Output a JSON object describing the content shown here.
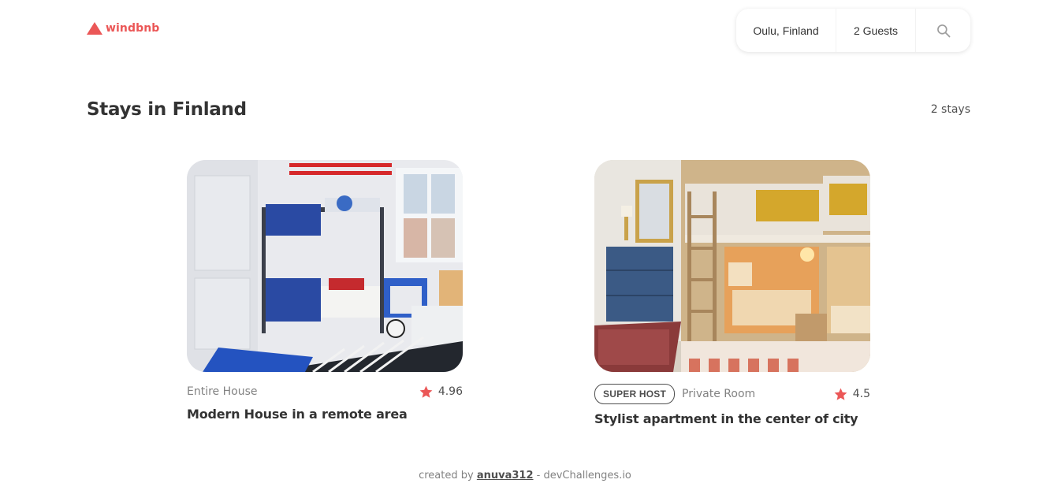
{
  "header": {
    "logo_text": "windbnb",
    "logo_icon": "triangle-logo-icon",
    "brand_color": "#EB5757"
  },
  "search": {
    "location": "Oulu, Finland",
    "guests": "2 Guests",
    "icon": "search-icon"
  },
  "main": {
    "title": "Stays in Finland",
    "count": "2 stays"
  },
  "stays": [
    {
      "type": "Entire House",
      "rating": "4.96",
      "title": "Modern House in a remote area",
      "superhost": false
    },
    {
      "superhost_label": "SUPER HOST",
      "type": "Private Room",
      "rating": "4.5",
      "title": "Stylist apartment in the center of city",
      "superhost": true
    }
  ],
  "footer": {
    "prefix": "created by",
    "author": "anuva312",
    "suffix": "- devChallenges.io"
  }
}
